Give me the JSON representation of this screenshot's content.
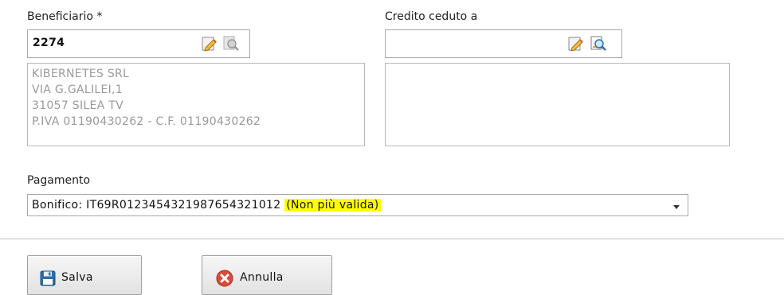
{
  "beneficiario": {
    "label": "Beneficiario",
    "required_mark": "*",
    "code_value": "2274",
    "address_lines": [
      "KIBERNETES SRL",
      "VIA G.GALILEI,1",
      "31057 SILEA TV",
      "P.IVA 01190430262 - C.F. 01190430262"
    ],
    "icons": [
      "edit-icon",
      "search-icon-disabled"
    ]
  },
  "credito": {
    "label": "Credito ceduto a",
    "code_value": "",
    "address_lines": [],
    "icons": [
      "edit-icon",
      "search-icon"
    ]
  },
  "pagamento": {
    "label": "Pagamento",
    "selected_text": "Bonifico: IT69R0123454321987654321012",
    "warning_text": "(Non più valida)",
    "warning_highlight": "#ffff00"
  },
  "buttons": {
    "save_label": "Salva",
    "cancel_label": "Annulla"
  }
}
